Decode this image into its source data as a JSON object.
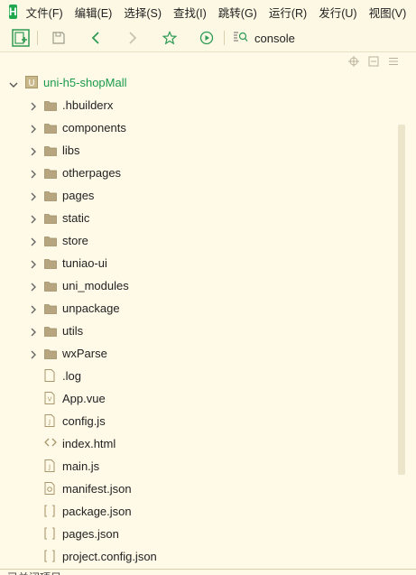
{
  "app": {
    "logo_letter": "H",
    "brand_color": "#1fa84e"
  },
  "menubar": {
    "items": [
      {
        "label": "文件(F)"
      },
      {
        "label": "编辑(E)"
      },
      {
        "label": "选择(S)"
      },
      {
        "label": "查找(I)"
      },
      {
        "label": "跳转(G)"
      },
      {
        "label": "运行(R)"
      },
      {
        "label": "发行(U)"
      },
      {
        "label": "视图(V)"
      }
    ]
  },
  "toolbar": {
    "icons": [
      "new-file-icon",
      "save-icon",
      "back-icon",
      "forward-icon",
      "star-icon",
      "run-icon",
      "search-icon"
    ],
    "search": {
      "value": "console"
    }
  },
  "panel_header": {
    "icons": [
      "target-icon",
      "collapse-icon",
      "menu-icon"
    ]
  },
  "project": {
    "name": "uni-h5-shopMall",
    "expanded": true
  },
  "tree": [
    {
      "label": ".hbuilderx",
      "type": "folder"
    },
    {
      "label": "components",
      "type": "folder"
    },
    {
      "label": "libs",
      "type": "folder"
    },
    {
      "label": "otherpages",
      "type": "folder"
    },
    {
      "label": "pages",
      "type": "folder"
    },
    {
      "label": "static",
      "type": "folder"
    },
    {
      "label": "store",
      "type": "folder"
    },
    {
      "label": "tuniao-ui",
      "type": "folder"
    },
    {
      "label": "uni_modules",
      "type": "folder"
    },
    {
      "label": "unpackage",
      "type": "folder"
    },
    {
      "label": "utils",
      "type": "folder"
    },
    {
      "label": "wxParse",
      "type": "folder"
    },
    {
      "label": ".log",
      "type": "file"
    },
    {
      "label": "App.vue",
      "type": "vue"
    },
    {
      "label": "config.js",
      "type": "js"
    },
    {
      "label": "index.html",
      "type": "html"
    },
    {
      "label": "main.js",
      "type": "js"
    },
    {
      "label": "manifest.json",
      "type": "manifest"
    },
    {
      "label": "package.json",
      "type": "json"
    },
    {
      "label": "pages.json",
      "type": "json"
    },
    {
      "label": "project.config.json",
      "type": "json"
    }
  ],
  "bottom": {
    "label": "已关闭项目"
  }
}
